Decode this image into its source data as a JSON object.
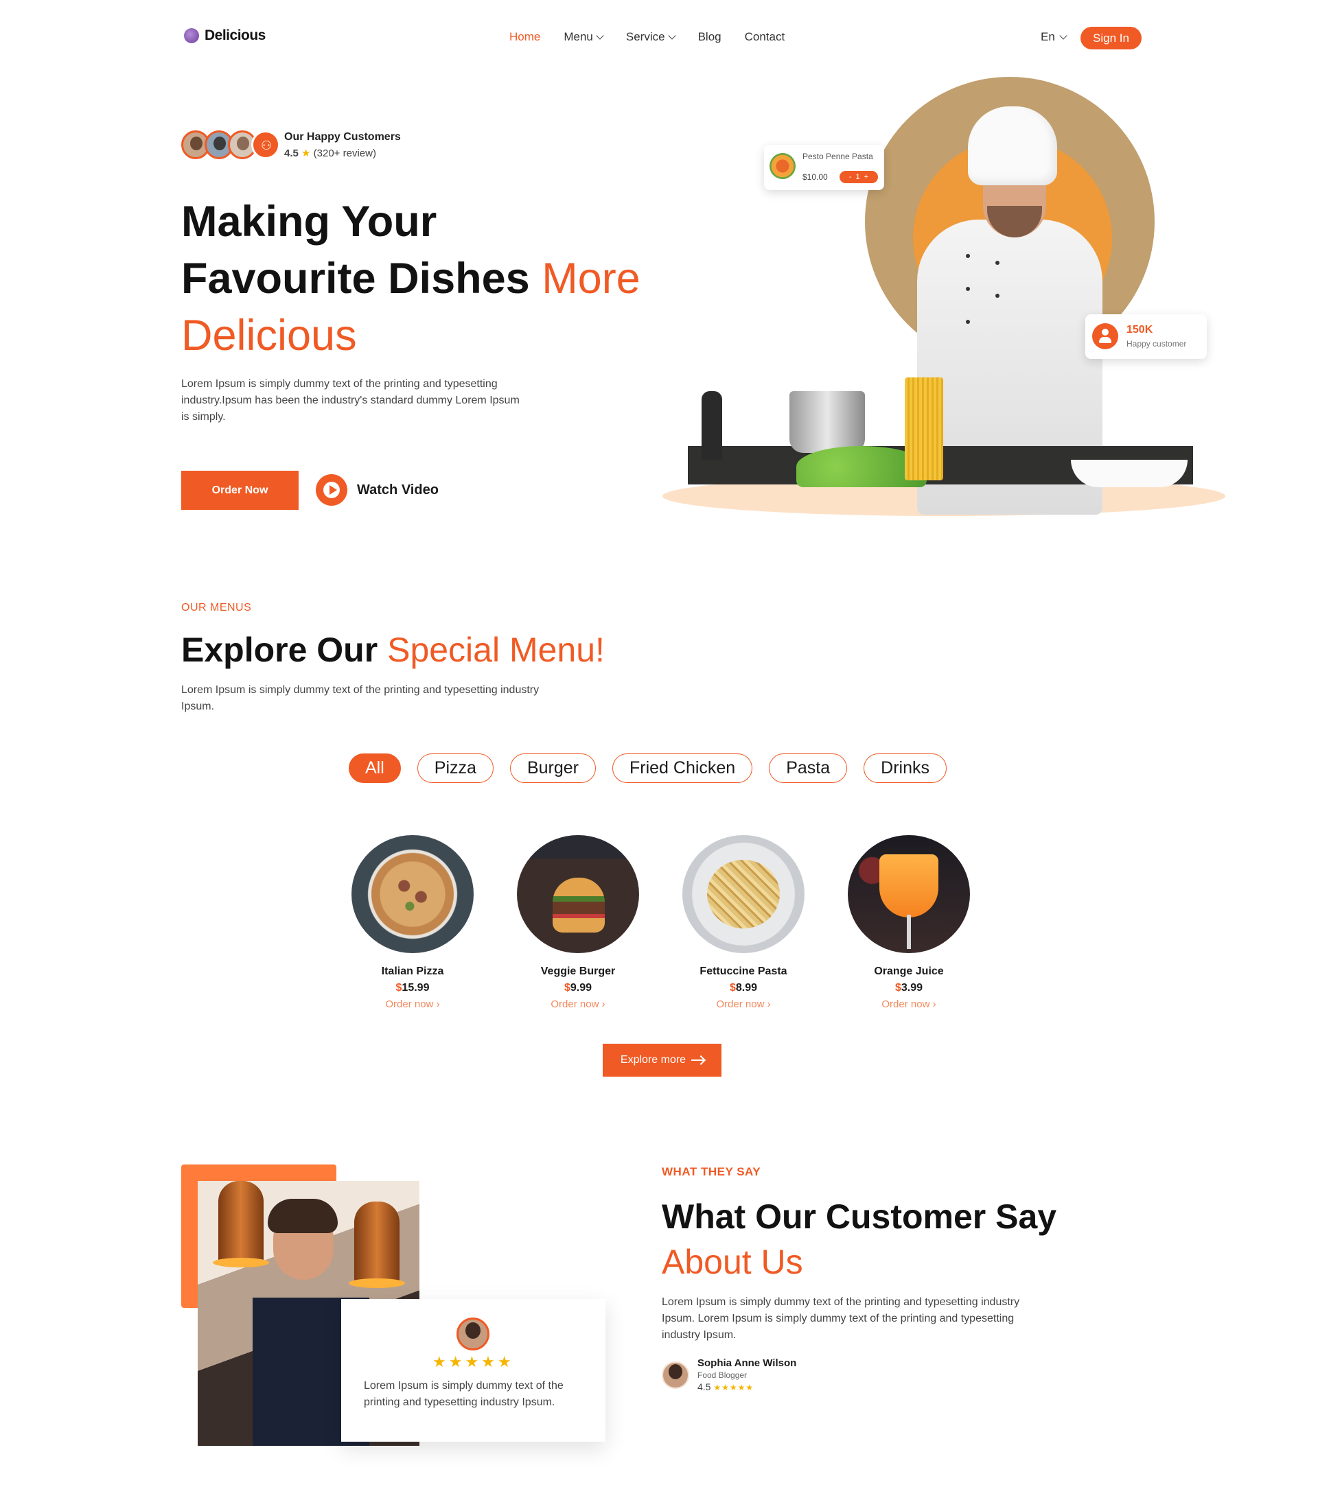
{
  "brand": {
    "name": "Delicious"
  },
  "nav": {
    "links": [
      {
        "label": "Home",
        "active": true,
        "dropdown": false
      },
      {
        "label": "Menu",
        "active": false,
        "dropdown": true
      },
      {
        "label": "Service",
        "active": false,
        "dropdown": true
      },
      {
        "label": "Blog",
        "active": false,
        "dropdown": false
      },
      {
        "label": "Contact",
        "active": false,
        "dropdown": false
      }
    ],
    "language": "En",
    "signin_label": "Sign In"
  },
  "hero": {
    "customers_title": "Our Happy Customers",
    "rating_value": "4.5",
    "rating_star": "★",
    "rating_reviews": "(320+ review)",
    "title_line1": "Making Your",
    "title_line2": "Favourite Dishes",
    "title_highlight_1": "More",
    "title_highlight_2": "Delicious",
    "description": "Lorem Ipsum is simply dummy text of the printing and typesetting industry.Ipsum has been the industry's standard dummy Lorem Ipsum is simply.",
    "order_label": "Order Now",
    "watch_label": "Watch Video",
    "product_card": {
      "name": "Pesto Penne Pasta",
      "price": "$10.00",
      "minus": "-",
      "qty": "1",
      "plus": "+"
    },
    "stat_card": {
      "value": "150K",
      "label": "Happy customer"
    }
  },
  "menu": {
    "eyebrow": "OUR MENUS",
    "title": "Explore Our",
    "title_highlight": "Special Menu!",
    "description": "Lorem Ipsum is simply dummy text of the printing and typesetting industry Ipsum.",
    "tabs": [
      {
        "label": "All",
        "active": true
      },
      {
        "label": "Pizza",
        "active": false
      },
      {
        "label": "Burger",
        "active": false
      },
      {
        "label": "Fried Chicken",
        "active": false
      },
      {
        "label": "Pasta",
        "active": false
      },
      {
        "label": "Drinks",
        "active": false
      }
    ],
    "items": [
      {
        "name": "Italian Pizza",
        "currency": "$",
        "price": "15.99",
        "order": "Order now ›",
        "image": "pizza"
      },
      {
        "name": "Veggie Burger",
        "currency": "$",
        "price": "9.99",
        "order": "Order now ›",
        "image": "burger"
      },
      {
        "name": "Fettuccine Pasta",
        "currency": "$",
        "price": "8.99",
        "order": "Order now ›",
        "image": "pasta"
      },
      {
        "name": "Orange Juice",
        "currency": "$",
        "price": "3.99",
        "order": "Order now ›",
        "image": "juice"
      }
    ],
    "explore_label": "Explore more"
  },
  "testimonial": {
    "eyebrow": "WHAT THEY SAY",
    "title": "What Our Customer Say",
    "title_highlight": "About Us",
    "description": "Lorem Ipsum is simply dummy text of the printing and typesetting industry Ipsum. Lorem Ipsum is simply dummy text of the printing and typesetting industry Ipsum.",
    "card_stars": "★★★★★",
    "card_text": "Lorem Ipsum is simply dummy text of the printing and typesetting industry Ipsum.",
    "reviewer": {
      "name": "Sophia Anne Wilson",
      "role": "Food Blogger",
      "rating": "4.5",
      "stars": "★★★★★"
    }
  },
  "colors": {
    "accent": "#f05a24",
    "accent_light": "#fe7b3a",
    "star": "#f5b500",
    "text": "#1b1b1b"
  }
}
